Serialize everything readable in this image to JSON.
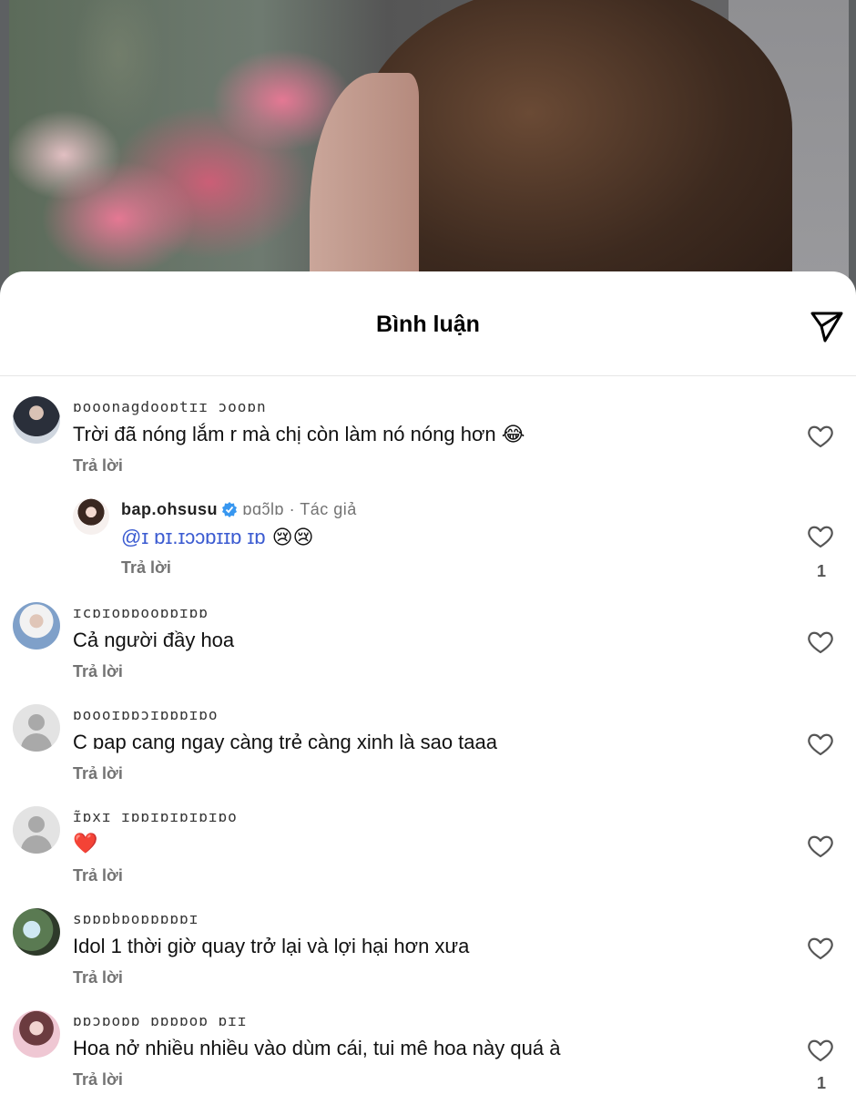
{
  "sheet": {
    "title": "Bình luận"
  },
  "reply_label": "Trả lời",
  "comments": [
    {
      "username": "ɒooonagdooɒtɪɪ ɔooɒn",
      "text": "Trời đã nóng lắm r mà chị còn làm nó nóng hơn 😂",
      "reply": "Trả lời"
    },
    {
      "username": "bap.ohsusu",
      "meta_extra": "ɒɑɔ̃lɒ",
      "author_tag": " · Tác giả",
      "mention": "@ɪ ɒɪ.ɪɔɔɒɪɪɒ ɪɒ",
      "emojis": " 😢😢",
      "reply": "Trả lời",
      "likes": "1"
    },
    {
      "username": "ɪcɒɪoɒɒooɒɒɪɒɒ",
      "text": "Cả người đầy hoa",
      "reply": "Trả lời"
    },
    {
      "username": "ɒoooɪɒɒɔɪɒɒɒɪɒo",
      "text": "C ɒap cang ngay càng trẻ càng xinh là sao taaa",
      "reply": "Trả lời"
    },
    {
      "username": "ɪ̃ɒxɪ ɪɒɒɪɒɪɒɪɒɪɒo",
      "text": "❤️",
      "reply": "Trả lời"
    },
    {
      "username": "sɒɒɒbɒoɒɒɒɒɒɪ",
      "text": "Idol 1 thời giờ quay trở lại và lợi hại hơn xưa",
      "reply": "Trả lời"
    },
    {
      "username": "ɒɒɔɒoɒɒ ɒɒɒɒoɒ   ɒɪɪ",
      "text": "Hoa nở nhiều nhiều vào dùm cái, tui mê hoa này quá à",
      "reply": "Trả lời",
      "likes": "1"
    }
  ],
  "icons": {
    "share": "paper-plane-icon",
    "like": "heart-icon",
    "verified": "verified-badge-icon"
  },
  "colors": {
    "verified": "#3897f0",
    "mention": "#3b5bd1",
    "secondary_text": "#737373"
  }
}
